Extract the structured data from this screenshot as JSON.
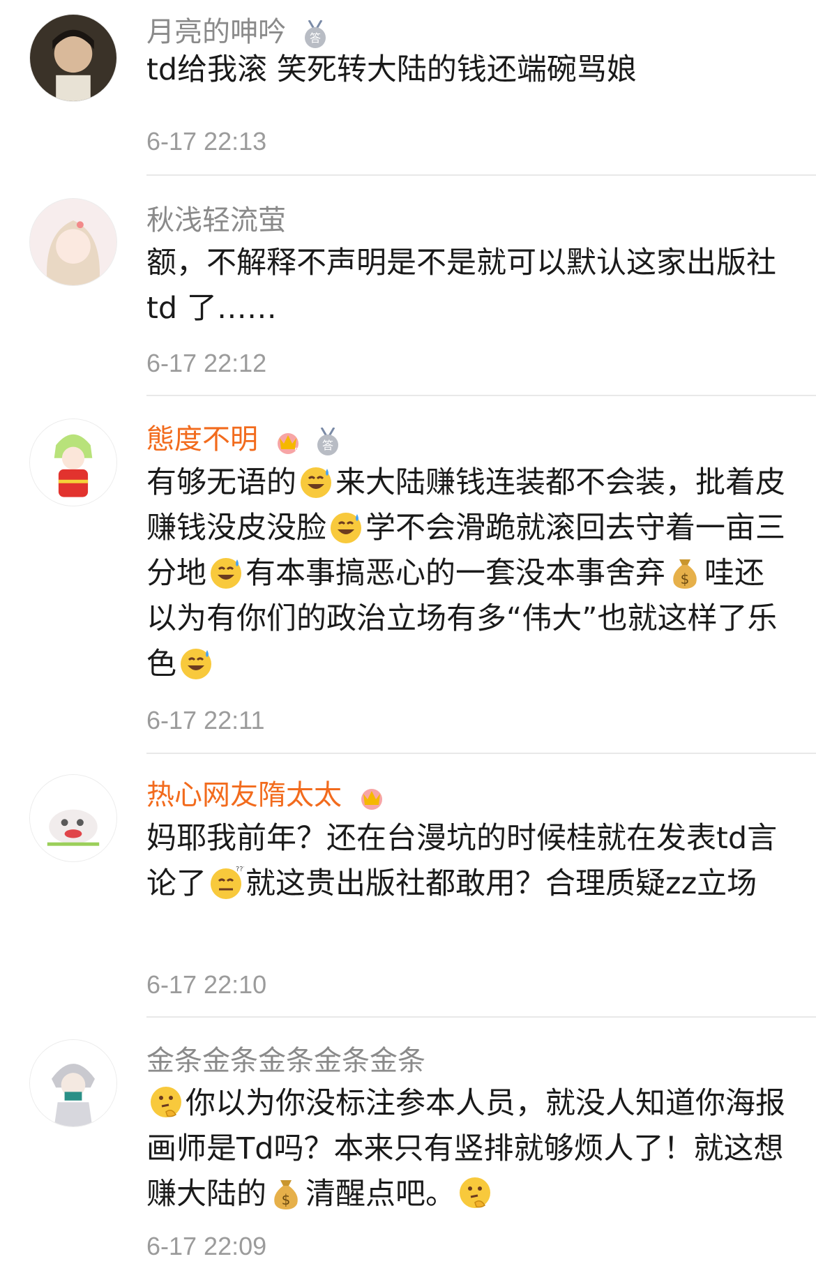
{
  "comments": [
    {
      "username": "月亮的呻吟",
      "text": "td给我滚 笑死转大陆的钱还端碗骂娘",
      "time": "6-17 22:13"
    },
    {
      "username": "秋浅轻流萤",
      "text": "额，不解释不声明是不是就可以默认这家出版社 td 了……",
      "time": "6-17 22:12"
    },
    {
      "username": "態度不明",
      "text_parts": [
        "有够无语的",
        "来大陆赚钱连装都不会装，批着皮赚钱没皮没脸",
        "学不会滑跪就滚回去守着一亩三分地",
        "有本事搞恶心的一套没本事舍弃",
        "哇还以为有你们的政治立场有多“伟大”也就这样了乐色"
      ],
      "time": "6-17 22:11"
    },
    {
      "username": "热心网友隋太太",
      "text_parts": [
        "妈耶我前年？还在台漫坑的时候桂就在发表td言论了",
        "就这贵出版社都敢用？合理质疑zz立场"
      ],
      "time": "6-17 22:10"
    },
    {
      "username": "金条金条金条金条金条",
      "text_parts": [
        "你以为你没标注参本人员，就没人知道你海报画师是Td吗？本来只有竖排就够烦人了！就这想赚大陆的",
        "清醒点吧。"
      ],
      "time": "6-17 22:09"
    }
  ],
  "colors": {
    "vip_name": "#f26b1d",
    "normal_name": "#8a8a8a",
    "text": "#1a1a1a",
    "time": "#9b9b9b"
  },
  "icons": [
    "answer-medal-icon",
    "crown-badge-icon",
    "sweat-smile-emoji",
    "money-bag-emoji",
    "thinking-emoji",
    "confused-emoji"
  ]
}
